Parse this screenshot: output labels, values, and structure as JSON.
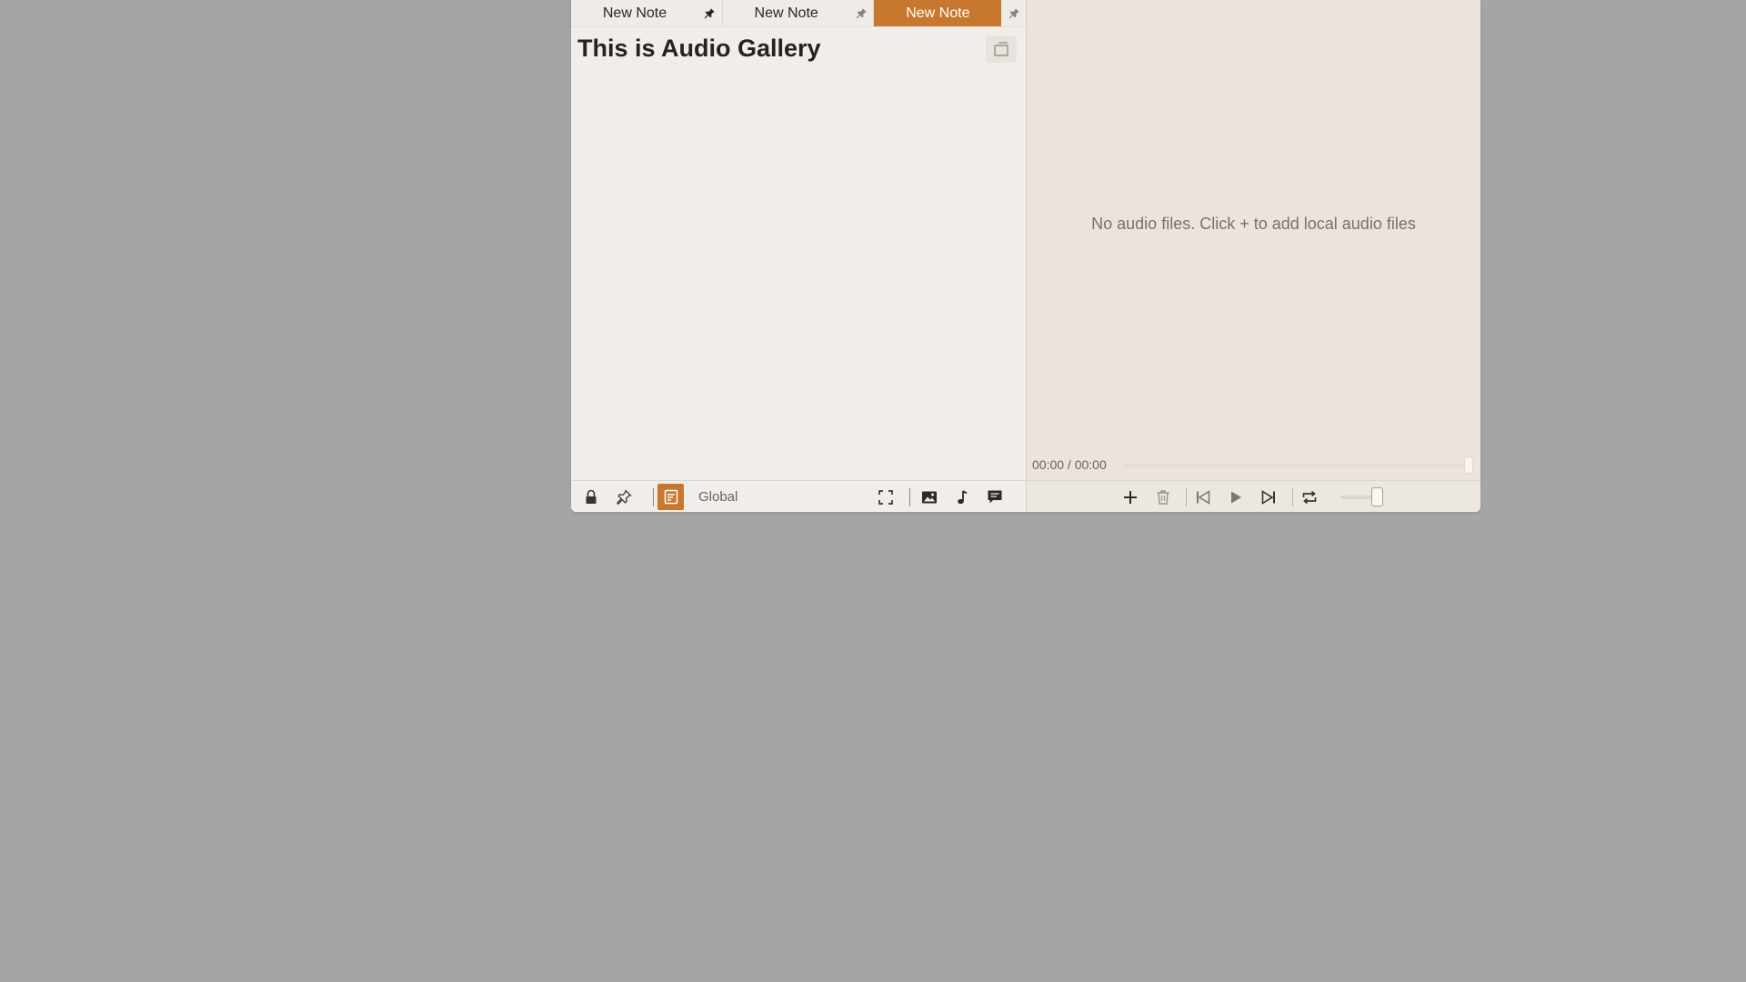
{
  "tabs": [
    {
      "label": "New Note",
      "pinned": true,
      "active": false
    },
    {
      "label": "New Note",
      "pinned": false,
      "active": false
    },
    {
      "label": "New Note",
      "pinned": false,
      "active": true
    }
  ],
  "note": {
    "title": "This is Audio Gallery"
  },
  "note_toolbar": {
    "scope_label": "Global",
    "icons": [
      "lock-icon",
      "pin-icon",
      "note-mode-icon",
      "fullscreen-icon",
      "image-icon",
      "music-icon",
      "comment-icon"
    ]
  },
  "audio": {
    "empty_message": "No audio files. Click + to add local audio files",
    "time_display": "00:00 / 00:00",
    "progress": 1.0,
    "volume": 0.8,
    "icons": [
      "add-icon",
      "delete-icon",
      "previous-icon",
      "play-icon",
      "next-icon",
      "repeat-icon"
    ]
  },
  "colors": {
    "accent": "#c8782e",
    "desktop": "#a5a5a5",
    "note_background": "#f1eeea",
    "audio_background": "#ebe3dc"
  }
}
